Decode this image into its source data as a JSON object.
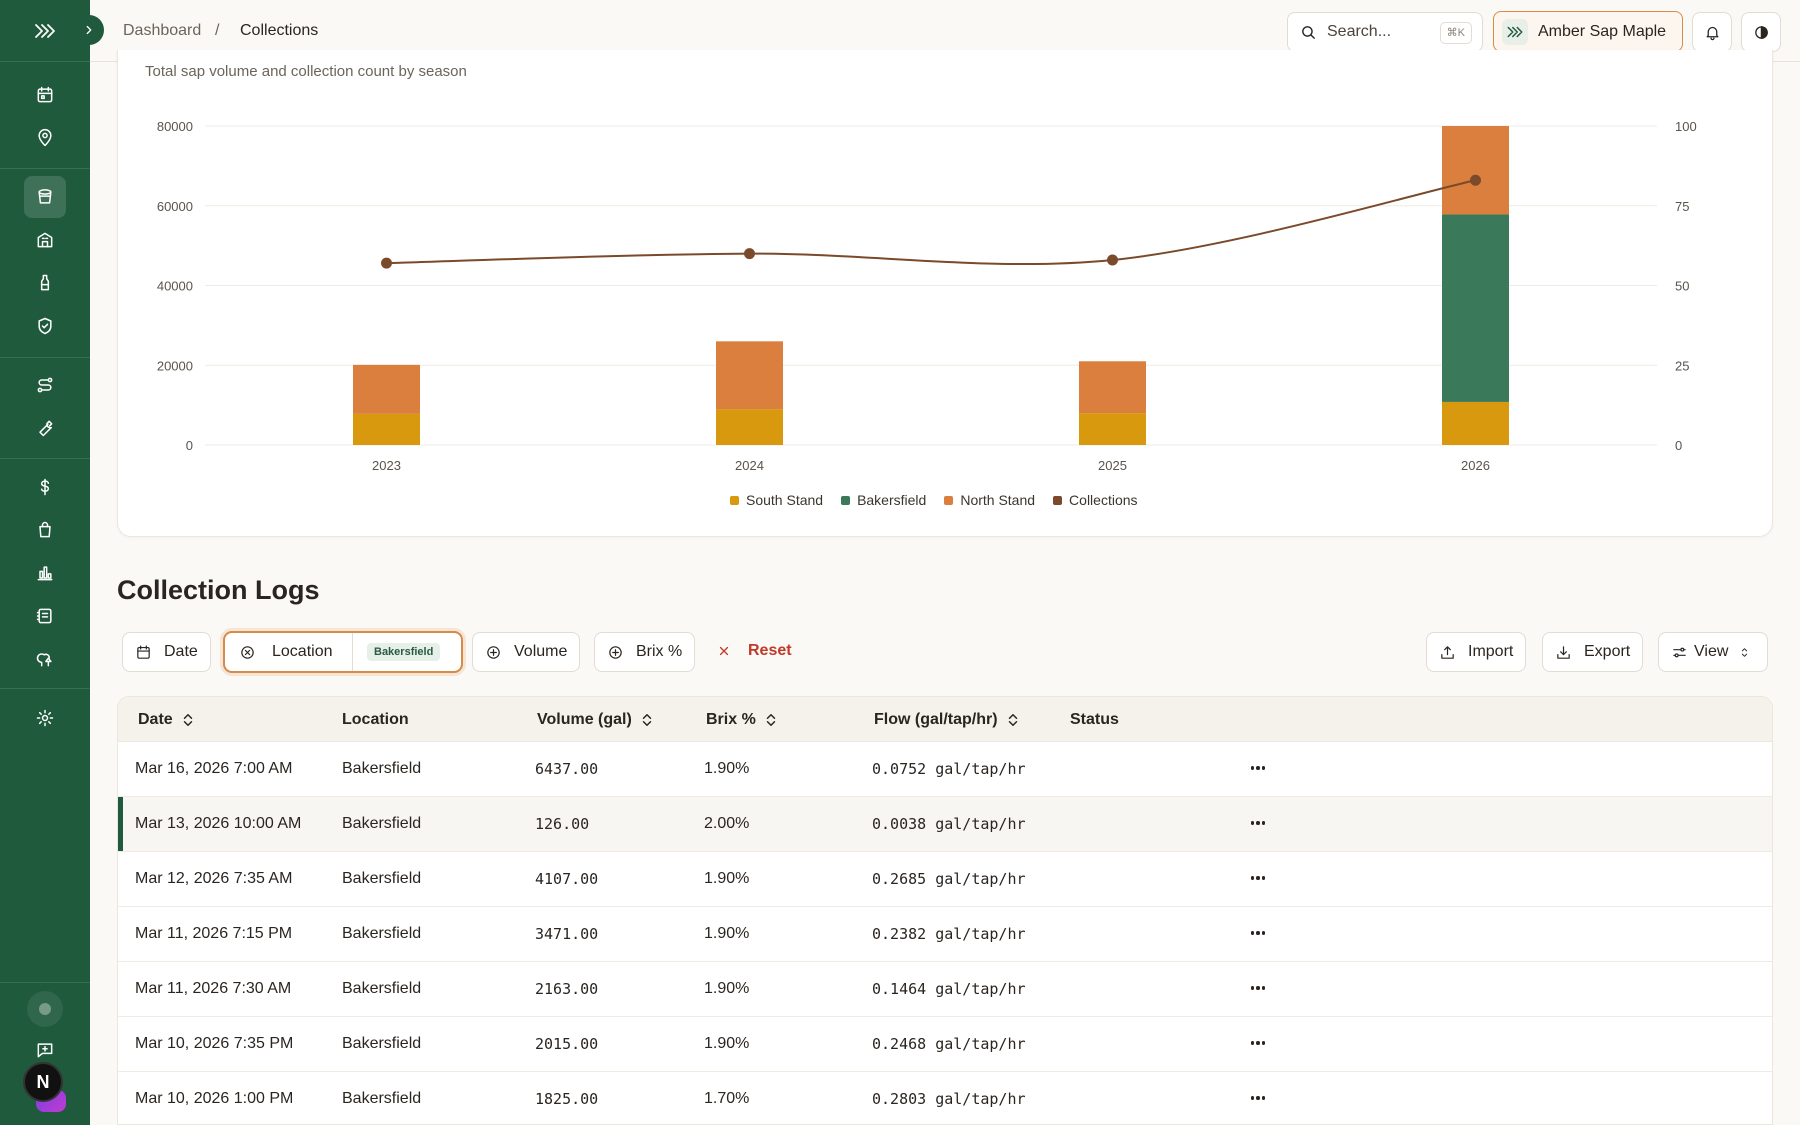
{
  "breadcrumb": {
    "root": "Dashboard",
    "separator": "/",
    "current": "Collections"
  },
  "header": {
    "search_placeholder": "Search...",
    "search_shortcut": "⌘K",
    "farm_name": "Amber Sap Maple"
  },
  "chart": {
    "subtitle": "Total sap volume and collection count by season"
  },
  "chart_data": {
    "type": "bar",
    "categories": [
      "2023",
      "2024",
      "2025",
      "2026"
    ],
    "stacked": true,
    "series": [
      {
        "name": "South Stand",
        "values": [
          7800,
          9000,
          8000,
          10800
        ],
        "color": "#d9990f"
      },
      {
        "name": "Bakersfield",
        "values": [
          0,
          0,
          0,
          47000
        ],
        "color": "#3a7a5a"
      },
      {
        "name": "North Stand",
        "values": [
          12300,
          17000,
          13000,
          22200
        ],
        "color": "#db7f3e"
      },
      {
        "name": "Collections",
        "type": "line",
        "axis": "right",
        "values": [
          57,
          60,
          58,
          83
        ],
        "color": "#7a4a2a"
      }
    ],
    "y_left": {
      "ticks": [
        "0",
        "20000",
        "40000",
        "60000",
        "80000"
      ],
      "range": [
        0,
        80000
      ]
    },
    "y_right": {
      "ticks": [
        "0",
        "25",
        "50",
        "75",
        "100"
      ],
      "range": [
        0,
        100
      ]
    },
    "legend_position": "bottom-center",
    "grid": true
  },
  "logs": {
    "title": "Collection Logs",
    "filters": {
      "date": "Date",
      "location": "Location",
      "location_value": "Bakersfield",
      "volume": "Volume",
      "brix": "Brix %",
      "reset": "Reset"
    },
    "actions": {
      "import": "Import",
      "export": "Export",
      "view": "View"
    },
    "columns": {
      "date": "Date",
      "location": "Location",
      "volume": "Volume (gal)",
      "brix": "Brix %",
      "flow": "Flow (gal/tap/hr)",
      "status": "Status"
    },
    "rows": [
      {
        "date": "Mar 16, 2026 7:00 AM",
        "location": "Bakersfield",
        "volume": "6437.00",
        "brix": "1.90%",
        "flow": "0.0752 gal/tap/hr"
      },
      {
        "date": "Mar 13, 2026 10:00 AM",
        "location": "Bakersfield",
        "volume": "126.00",
        "brix": "2.00%",
        "flow": "0.0038 gal/tap/hr"
      },
      {
        "date": "Mar 12, 2026 7:35 AM",
        "location": "Bakersfield",
        "volume": "4107.00",
        "brix": "1.90%",
        "flow": "0.2685 gal/tap/hr"
      },
      {
        "date": "Mar 11, 2026 7:15 PM",
        "location": "Bakersfield",
        "volume": "3471.00",
        "brix": "1.90%",
        "flow": "0.2382 gal/tap/hr"
      },
      {
        "date": "Mar 11, 2026 7:30 AM",
        "location": "Bakersfield",
        "volume": "2163.00",
        "brix": "1.90%",
        "flow": "0.1464 gal/tap/hr"
      },
      {
        "date": "Mar 10, 2026 7:35 PM",
        "location": "Bakersfield",
        "volume": "2015.00",
        "brix": "1.90%",
        "flow": "0.2468 gal/tap/hr"
      },
      {
        "date": "Mar 10, 2026 1:00 PM",
        "location": "Bakersfield",
        "volume": "1825.00",
        "brix": "1.70%",
        "flow": "0.2803 gal/tap/hr"
      }
    ]
  },
  "user": {
    "avatar_initial": "N"
  }
}
